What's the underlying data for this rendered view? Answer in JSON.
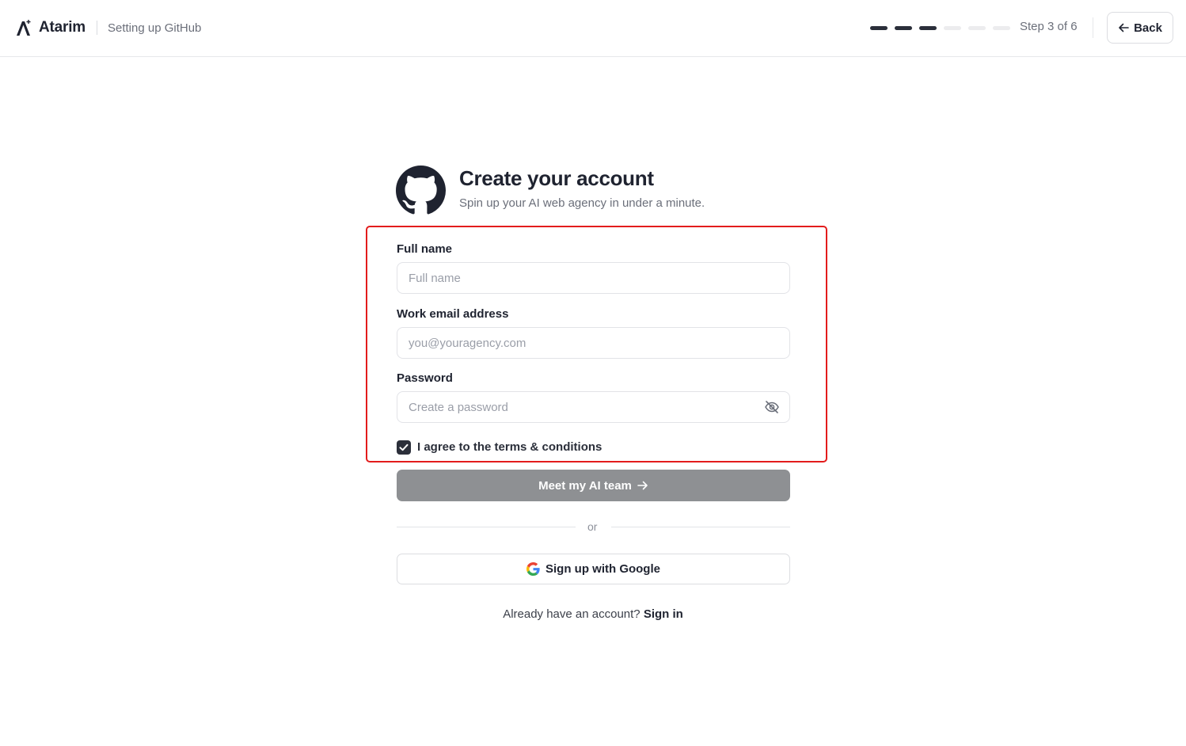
{
  "header": {
    "brand_name": "Atarim",
    "subtitle": "Setting up GitHub",
    "progress": {
      "current_step": 3,
      "total_steps": 6
    },
    "step_text": "Step 3 of 6",
    "back_label": "Back"
  },
  "signup": {
    "title": "Create your account",
    "subtitle": "Spin up your AI web agency in under a minute.",
    "provider_icon": "github-icon",
    "full_name": {
      "label": "Full name",
      "value": "",
      "placeholder": "Full name"
    },
    "email": {
      "label": "Work email address",
      "value": "",
      "placeholder": "you@youragency.com"
    },
    "password": {
      "label": "Password",
      "value": "",
      "placeholder": "Create a password",
      "toggle_icon": "eye-off-icon"
    },
    "terms": {
      "checked": true,
      "label": "I agree to the terms & conditions"
    },
    "submit_label": "Meet my AI team",
    "divider_text": "or",
    "google_label": "Sign up with Google",
    "signin_prompt": "Already have an account?",
    "signin_link": "Sign in"
  },
  "colors": {
    "highlight": "#e31c1c",
    "primary_disabled": "#8e9093",
    "text_dark": "#1f2330",
    "progress_done": "#2b2f3a",
    "progress_todo": "#ececee"
  }
}
